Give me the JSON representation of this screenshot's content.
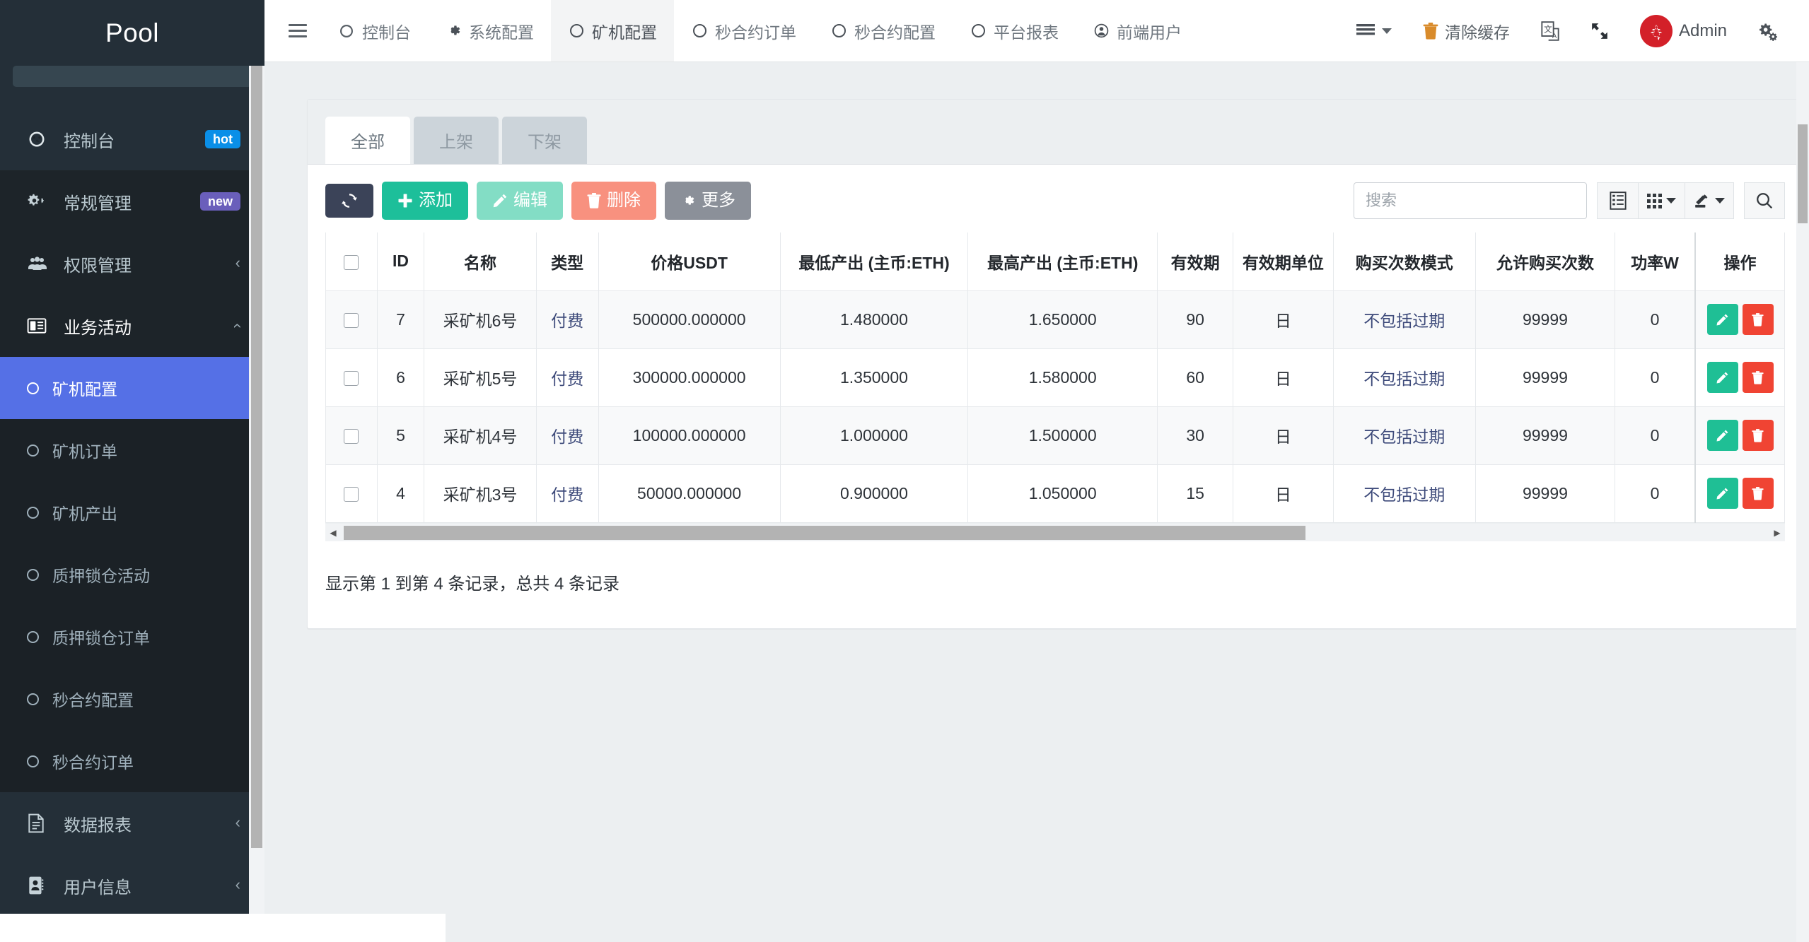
{
  "sidebar": {
    "brand": "Pool",
    "items": [
      {
        "label": "控制台",
        "icon": "dashboard-icon",
        "badge": "hot",
        "badge_type": "hot",
        "level": 1,
        "tinted": true
      },
      {
        "label": "常规管理",
        "icon": "gears-icon",
        "badge": "new",
        "badge_type": "new",
        "level": 1,
        "tinted": false
      },
      {
        "label": "权限管理",
        "icon": "users-icon",
        "chevron": "‹",
        "level": 1,
        "tinted": false
      },
      {
        "label": "业务活动",
        "icon": "book-icon",
        "chevron": "‹",
        "level": 1,
        "tinted": false,
        "expanded": true,
        "active_parent": true
      }
    ],
    "sub_items": [
      {
        "label": "矿机配置",
        "selected": true
      },
      {
        "label": "矿机订单",
        "selected": false
      },
      {
        "label": "矿机产出",
        "selected": false
      },
      {
        "label": "质押锁仓活动",
        "selected": false
      },
      {
        "label": "质押锁仓订单",
        "selected": false
      },
      {
        "label": "秒合约配置",
        "selected": false
      },
      {
        "label": "秒合约订单",
        "selected": false
      }
    ],
    "bottom_items": [
      {
        "label": "数据报表",
        "icon": "report-icon",
        "chevron": "‹"
      },
      {
        "label": "用户信息",
        "icon": "contact-icon",
        "chevron": "‹"
      }
    ]
  },
  "topbar": {
    "menu_toggle": "hamburger-icon",
    "nav": [
      {
        "label": "控制台",
        "icon": "speedometer-icon",
        "active": false
      },
      {
        "label": "系统配置",
        "icon": "gear-icon",
        "active": false
      },
      {
        "label": "矿机配置",
        "icon": "circle-icon",
        "active": true
      },
      {
        "label": "秒合约订单",
        "icon": "circle-icon",
        "active": false
      },
      {
        "label": "秒合约配置",
        "icon": "circle-icon",
        "active": false
      },
      {
        "label": "平台报表",
        "icon": "circle-icon",
        "active": false
      },
      {
        "label": "前端用户",
        "icon": "user-circle-icon",
        "active": false
      }
    ],
    "right": {
      "list_menu": "list-menu-icon",
      "clear_cache": "清除缓存",
      "translate": "translate-icon",
      "fullscreen": "fullscreen-icon",
      "avatar_flag": "hongkong-flag-avatar",
      "user_name": "Admin",
      "settings": "gear-icon"
    }
  },
  "panel": {
    "tabs": [
      {
        "label": "全部",
        "active": true
      },
      {
        "label": "上架",
        "active": false
      },
      {
        "label": "下架",
        "active": false
      }
    ],
    "toolbar": {
      "refresh": {
        "label": "",
        "icon": "refresh-icon"
      },
      "add": {
        "label": "添加",
        "icon": "plus-icon"
      },
      "edit": {
        "label": "编辑",
        "icon": "pencil-icon"
      },
      "delete": {
        "label": "删除",
        "icon": "trash-icon"
      },
      "more": {
        "label": "更多",
        "icon": "gear-icon"
      }
    },
    "search": {
      "placeholder": "搜索",
      "value": ""
    },
    "view_icons": {
      "list": "list-view-icon",
      "columns": "columns-grid-icon",
      "export": "export-icon",
      "search": "magnifier-icon"
    },
    "table": {
      "columns": [
        "",
        "ID",
        "名称",
        "类型",
        "价格USDT",
        "最低产出 (主币:ETH)",
        "最高产出 (主币:ETH)",
        "有效期",
        "有效期单位",
        "购买次数模式",
        "允许购买次数",
        "功率W",
        "操作"
      ],
      "rows": [
        {
          "id": "7",
          "name": "采矿机6号",
          "type": "付费",
          "price": "500000.000000",
          "min_output": "1.480000",
          "max_output": "1.650000",
          "validity": "90",
          "validity_unit": "日",
          "buy_mode": "不包括过期",
          "allow_count": "99999",
          "power": "0"
        },
        {
          "id": "6",
          "name": "采矿机5号",
          "type": "付费",
          "price": "300000.000000",
          "min_output": "1.350000",
          "max_output": "1.580000",
          "validity": "60",
          "validity_unit": "日",
          "buy_mode": "不包括过期",
          "allow_count": "99999",
          "power": "0"
        },
        {
          "id": "5",
          "name": "采矿机4号",
          "type": "付费",
          "price": "100000.000000",
          "min_output": "1.000000",
          "max_output": "1.500000",
          "validity": "30",
          "validity_unit": "日",
          "buy_mode": "不包括过期",
          "allow_count": "99999",
          "power": "0"
        },
        {
          "id": "4",
          "name": "采矿机3号",
          "type": "付费",
          "price": "50000.000000",
          "min_output": "0.900000",
          "max_output": "1.050000",
          "validity": "15",
          "validity_unit": "日",
          "buy_mode": "不包括过期",
          "allow_count": "99999",
          "power": "0"
        }
      ],
      "row_actions": {
        "edit": "pencil-icon",
        "delete": "trash-icon"
      },
      "footer": "显示第 1 到第 4 条记录，总共 4 条记录"
    }
  },
  "colors": {
    "sidebar_bg": "#1d2429",
    "sidebar_header": "#242f38",
    "selected_item": "#5570e6",
    "badge_hot": "#0a8fe8",
    "badge_new": "#6a5fbb",
    "btn_add": "#1dbf9a",
    "btn_edit": "#83ddc5",
    "btn_delete": "#f8917f",
    "btn_more": "#8b9099",
    "btn_refresh": "#3b4358",
    "op_edit": "#1fbf95",
    "op_delete": "#f04433",
    "avatar": "#d32029",
    "content_bg": "#eceff1"
  }
}
